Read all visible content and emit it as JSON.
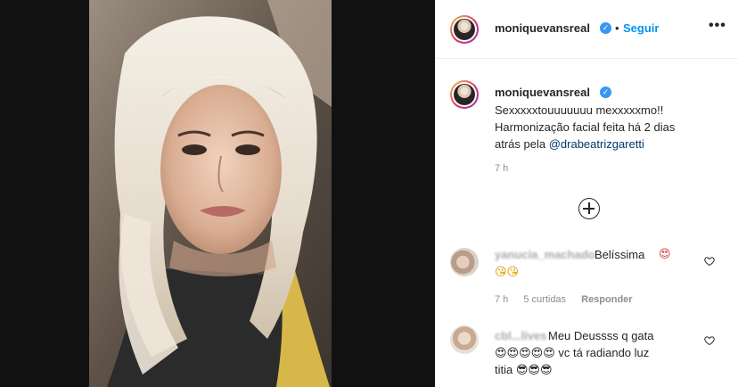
{
  "post": {
    "username": "moniquevansreal",
    "follow_label": "Seguir",
    "separator": "•",
    "more_label": "•••",
    "verified_mark": "✓",
    "caption_line1": "Sexxxxxtouuuuuuu mexxxxxmo!!",
    "caption_line2": "Harmonização facial feita há 2 dias",
    "caption_line3_prefix": "atrás pela ",
    "caption_mention": "@drabeatrizgaretti",
    "time": "7 h"
  },
  "comments": [
    {
      "username": "yanucia_machado",
      "text": "Belíssima",
      "emoji_inline": "😍",
      "emoji_line2": "😘😘",
      "time": "7 h",
      "likes": "5 curtidas",
      "reply_label": "Responder"
    },
    {
      "username": "cbl...lives",
      "text": "Meu Deussss q gata",
      "line2": "😍😍😍😍😍 vc tá radiando luz",
      "line3": "titia 😎😎😎"
    }
  ],
  "icons": {
    "load_more": "plus-circle-icon",
    "heart": "heart-outline-icon",
    "verified": "verified-badge-icon",
    "more": "more-options-icon"
  },
  "colors": {
    "accent": "#0095f6",
    "verified": "#3897f0",
    "muted": "#8e8e8e",
    "mention": "#00376b",
    "media_bg": "#111111"
  }
}
